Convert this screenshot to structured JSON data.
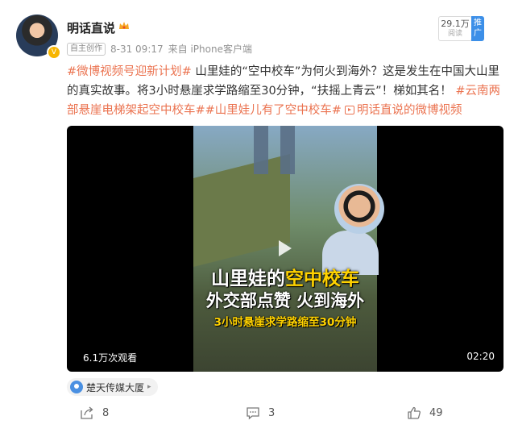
{
  "author": {
    "name": "明话直说",
    "badge_icon": "crown-icon",
    "verified_icon": "v-badge-icon"
  },
  "meta": {
    "origin_badge": "自主创作",
    "time": "8-31 09:17",
    "source": "来自 iPhone客户端"
  },
  "stats_badge": {
    "value": "29.1万",
    "label": "阅读",
    "promo": "推广"
  },
  "post": {
    "tag1": "#微博视频号迎新计划#",
    "text1": " 山里娃的“空中校车”为何火到海外？这是发生在中国大山里的真实故事。将3小时悬崖求学路缩至30分钟，“扶摇上青云”！梯如其名！ ",
    "tag2": "#云南两部悬崖电梯架起空中校车#",
    "tag3": "#山里娃儿有了空中校车#",
    "link_text": "明话直说的微博视频"
  },
  "video": {
    "caption_part1": "山里娃的",
    "caption_highlight": "空中校车",
    "caption_line2": "外交部点赞 火到海外",
    "caption_line3": "3小时悬崖求学路缩至30分钟",
    "play_count": "6.1万次观看",
    "duration": "02:20"
  },
  "location": {
    "name": "楚天传媒大厦",
    "chevron": "▸"
  },
  "actions": {
    "share_count": "8",
    "comment_count": "3",
    "like_count": "49"
  },
  "colors": {
    "tag": "#eb7350",
    "promo": "#3c8fe8",
    "verified": "#f7b500"
  }
}
